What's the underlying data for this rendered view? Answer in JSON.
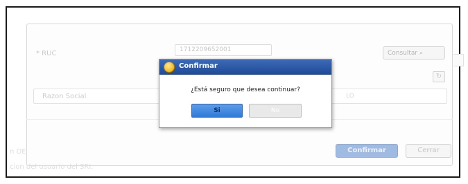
{
  "background_form": {
    "ruc_label": "* RUC",
    "ruc_value": "1712209652001",
    "consultar_label": "Consultar",
    "razon_social_label": "Razon Social",
    "razon_right_text": "LO",
    "confirmar_label": "Confirmar",
    "cerrar_label": "Cerrar",
    "footer_text_1": "n DE",
    "footer_text_2": "cion del usuario del SRI."
  },
  "dialog": {
    "title": "Confirmar",
    "message": "¿Está seguro que desea continuar?",
    "yes_label": "Si",
    "no_label": "No"
  },
  "colors": {
    "dialog_titlebar": "#1e4a96",
    "yes_button": "#2f79d8"
  }
}
